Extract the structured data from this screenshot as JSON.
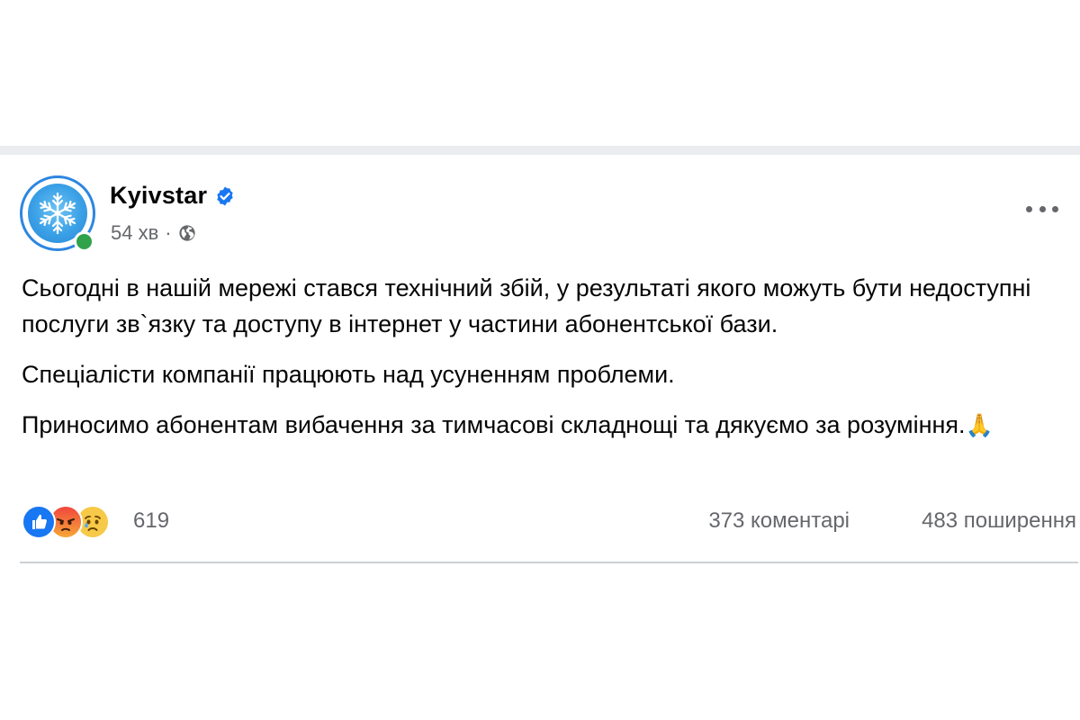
{
  "post": {
    "author": "Kyivstar",
    "time": "54 хв",
    "separator": "·",
    "paragraphs": [
      "Сьогодні в нашій мережі стався технічний збій, у результаті якого можуть бути недоступні послуги зв`язку та доступу в інтернет у частини абонентської бази.",
      "Спеціалісти компанії працюють над усуненням проблеми.",
      "Приносимо абонентам вибачення за тимчасові складнощі та дякуємо за розуміння."
    ],
    "emoji": "🙏"
  },
  "engagement": {
    "reaction_count": "619",
    "comments": "373 коментарі",
    "shares": "483 поширення"
  },
  "icons": {
    "verified": "verified-badge-icon",
    "audience": "globe-icon",
    "more": "more-options-icon",
    "reactions": [
      "like-icon",
      "angry-icon",
      "sad-icon"
    ]
  },
  "colors": {
    "accent": "#1877f2",
    "secondary_text": "#65676b",
    "online": "#31a24c",
    "avatar_ring": "#2e86e0"
  }
}
